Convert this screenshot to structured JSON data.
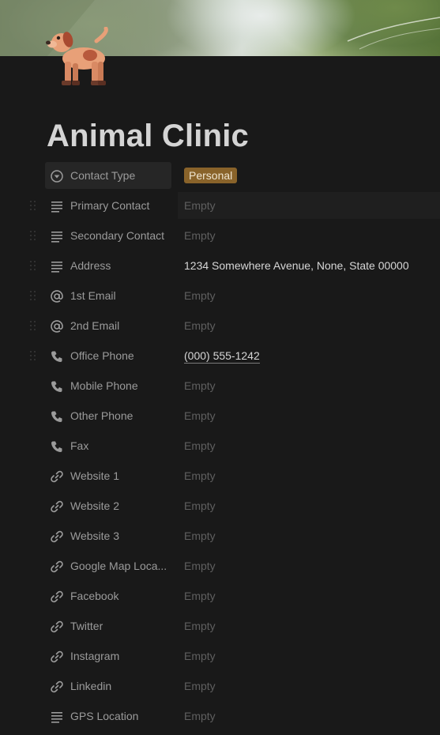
{
  "page": {
    "title": "Animal Clinic",
    "icon": "dog-icon"
  },
  "properties": [
    {
      "name": "Contact Type",
      "icon": "select-icon",
      "value": "Personal",
      "kind": "tag",
      "tag_color": "#89632a"
    },
    {
      "name": "Primary Contact",
      "icon": "text-icon",
      "value": "Empty",
      "kind": "empty"
    },
    {
      "name": "Secondary Contact",
      "icon": "text-icon",
      "value": "Empty",
      "kind": "empty"
    },
    {
      "name": "Address",
      "icon": "text-icon",
      "value": "1234 Somewhere Avenue, None, State 00000",
      "kind": "filled"
    },
    {
      "name": "1st Email",
      "icon": "email-icon",
      "value": "Empty",
      "kind": "empty"
    },
    {
      "name": "2nd Email",
      "icon": "email-icon",
      "value": "Empty",
      "kind": "empty"
    },
    {
      "name": "Office Phone",
      "icon": "phone-icon",
      "value": "(000) 555-1242",
      "kind": "phone"
    },
    {
      "name": "Mobile Phone",
      "icon": "phone-icon",
      "value": "Empty",
      "kind": "empty"
    },
    {
      "name": "Other Phone",
      "icon": "phone-icon",
      "value": "Empty",
      "kind": "empty"
    },
    {
      "name": "Fax",
      "icon": "phone-icon",
      "value": "Empty",
      "kind": "empty"
    },
    {
      "name": "Website 1",
      "icon": "link-icon",
      "value": "Empty",
      "kind": "empty"
    },
    {
      "name": "Website 2",
      "icon": "link-icon",
      "value": "Empty",
      "kind": "empty"
    },
    {
      "name": "Website 3",
      "icon": "link-icon",
      "value": "Empty",
      "kind": "empty"
    },
    {
      "name": "Google Map Loca...",
      "icon": "link-icon",
      "value": "Empty",
      "kind": "empty"
    },
    {
      "name": "Facebook",
      "icon": "link-icon",
      "value": "Empty",
      "kind": "empty"
    },
    {
      "name": "Twitter",
      "icon": "link-icon",
      "value": "Empty",
      "kind": "empty"
    },
    {
      "name": "Instagram",
      "icon": "link-icon",
      "value": "Empty",
      "kind": "empty"
    },
    {
      "name": "Linkedin",
      "icon": "link-icon",
      "value": "Empty",
      "kind": "empty"
    },
    {
      "name": "GPS Location",
      "icon": "text-icon",
      "value": "Empty",
      "kind": "empty"
    }
  ]
}
